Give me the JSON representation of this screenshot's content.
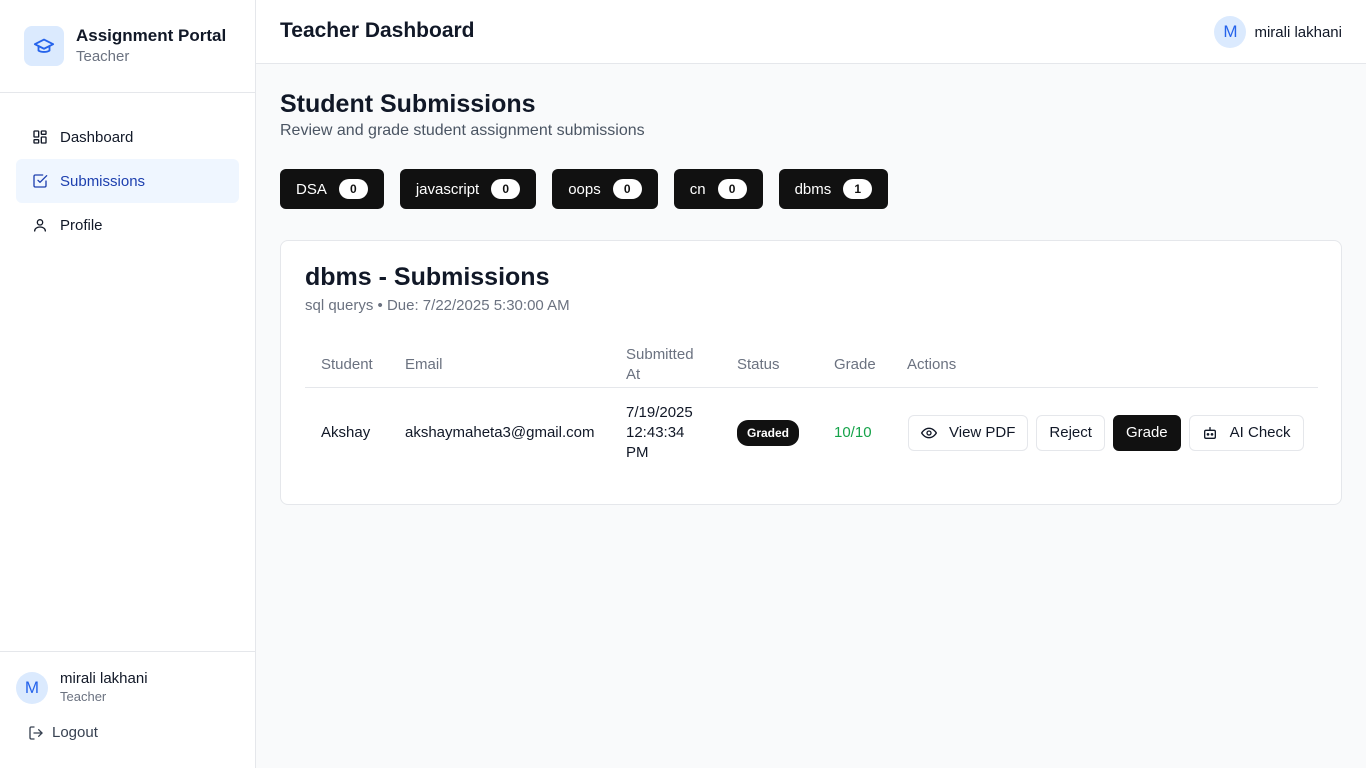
{
  "app": {
    "title": "Assignment Portal",
    "role": "Teacher"
  },
  "sidebar": {
    "items": [
      {
        "label": "Dashboard",
        "icon": "dashboard-icon",
        "active": false
      },
      {
        "label": "Submissions",
        "icon": "checklist-icon",
        "active": true
      },
      {
        "label": "Profile",
        "icon": "user-icon",
        "active": false
      }
    ],
    "user": {
      "initial": "M",
      "name": "mirali lakhani",
      "role": "Teacher"
    },
    "logout_label": "Logout"
  },
  "header": {
    "title": "Teacher Dashboard",
    "user_initial": "M",
    "user_name": "mirali lakhani"
  },
  "page": {
    "title": "Student Submissions",
    "subtitle": "Review and grade student assignment submissions"
  },
  "tabs": [
    {
      "label": "DSA",
      "count": "0"
    },
    {
      "label": "javascript",
      "count": "0"
    },
    {
      "label": "oops",
      "count": "0"
    },
    {
      "label": "cn",
      "count": "0"
    },
    {
      "label": "dbms",
      "count": "1"
    }
  ],
  "card": {
    "title": "dbms - Submissions",
    "subtitle": "sql querys • Due: 7/22/2025 5:30:00 AM",
    "columns": {
      "student": "Student",
      "email": "Email",
      "submitted_1": "Submitted",
      "submitted_2": "At",
      "status": "Status",
      "grade": "Grade",
      "actions": "Actions"
    },
    "rows": [
      {
        "student": "Akshay",
        "email": "akshaymaheta3@gmail.com",
        "submitted_1": "7/19/2025",
        "submitted_2": "12:43:34",
        "submitted_3": "PM",
        "status": "Graded",
        "grade": "10/10",
        "actions": {
          "view": "View PDF",
          "reject": "Reject",
          "grade": "Grade",
          "ai": "AI Check"
        }
      }
    ]
  },
  "colors": {
    "accent": "#2563eb",
    "active_bg": "#eff6ff",
    "dark": "#111111",
    "success": "#16a34a"
  }
}
